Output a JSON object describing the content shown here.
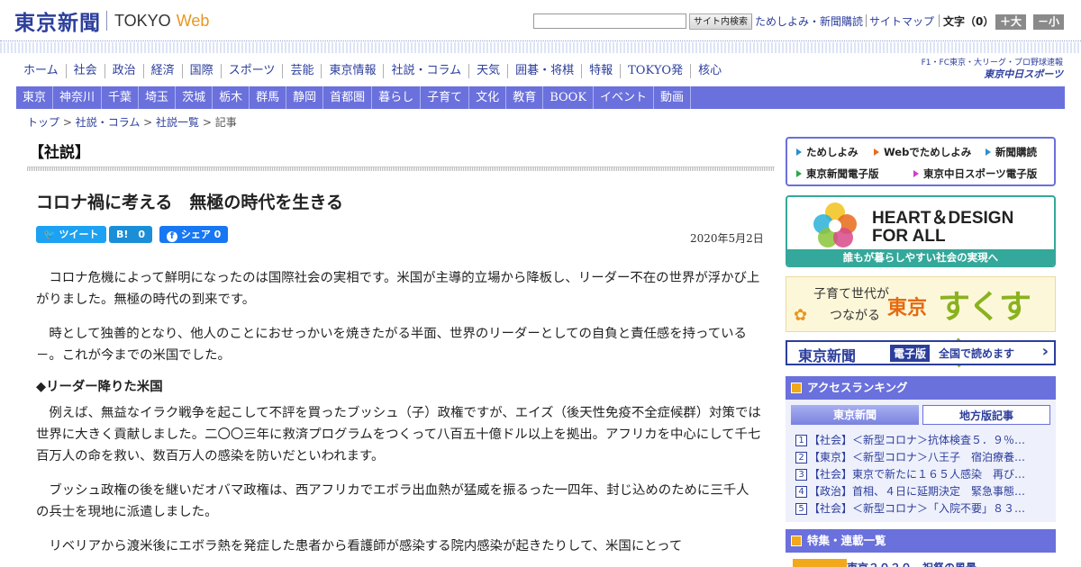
{
  "header": {
    "logo_jp": "東京新聞",
    "logo_en1": "TOKYO",
    "logo_en2": "Web",
    "search_button": "サイト内検索",
    "links": [
      "ためしよみ・新聞購読",
      "サイトマップ"
    ],
    "fontsize_label": "文字（0）",
    "font_bigger": "＋大",
    "font_smaller": "－小"
  },
  "nav_primary": [
    "ホーム",
    "社会",
    "政治",
    "経済",
    "国際",
    "スポーツ",
    "芸能",
    "東京情報",
    "社説・コラム",
    "天気",
    "囲碁・将棋",
    "特報",
    "TOKYO発",
    "核心"
  ],
  "chunichi": {
    "line1": "F1・FC東京・大リーグ・プロ野球速報",
    "line2": "東京中日スポーツ"
  },
  "nav_regional": [
    "東京",
    "神奈川",
    "千葉",
    "埼玉",
    "茨城",
    "栃木",
    "群馬",
    "静岡",
    "首都圏",
    "暮らし",
    "子育て",
    "文化",
    "教育",
    "BOOK",
    "イベント",
    "動画"
  ],
  "breadcrumb": {
    "items": [
      "トップ",
      "社説・コラム",
      "社説一覧"
    ],
    "current": "記事",
    "sep": " > "
  },
  "article": {
    "section": "【社説】",
    "headline": "コロナ禍に考える　無極の時代を生きる",
    "share": {
      "tweet": "ツイート",
      "hatena": "B!　0",
      "facebook": "シェア 0"
    },
    "date": "2020年5月2日",
    "paragraphs": [
      "コロナ危機によって鮮明になったのは国際社会の実相です。米国が主導的立場から降板し、リーダー不在の世界が浮かび上がりました。無極の時代の到来です。",
      "時として独善的となり、他人のことにおせっかいを焼きたがる半面、世界のリーダーとしての自負と責任感を持っている－。これが今までの米国でした。",
      "例えば、無益なイラク戦争を起こして不評を買ったブッシュ（子）政権ですが、エイズ（後天性免疫不全症候群）対策では世界に大きく貢献しました。二〇〇三年に救済プログラムをつくって八百五十億ドル以上を拠出。アフリカを中心にして千七百万人の命を救い、数百万人の感染を防いだといわれます。",
      "ブッシュ政権の後を継いだオバマ政権は、西アフリカでエボラ出血熱が猛威を振るった一四年、封じ込めのために三千人の兵士を現地に派遣しました。",
      "リベリアから渡米後にエボラ熱を発症した患者から看護師が感染する院内感染が起きたりして、米国にとって"
    ],
    "subhead": "◆リーダー降りた米国"
  },
  "sidebar": {
    "links": [
      "ためしよみ",
      "Webでためしよみ",
      "新聞購読",
      "東京新聞電子版",
      "東京中日スポーツ電子版"
    ],
    "heart_line1": "HEART＆DESIGN",
    "heart_line2": "FOR ALL",
    "heart_caption": "誰もが暮らしやすい社会の実現へ",
    "suku_line1": "子育て世代が",
    "suku_line2": "つながる",
    "suku_tokyo": "東京",
    "suku_logo": "すくすく",
    "eshimbun_title": "東京新聞",
    "eshimbun_badge": "電子版",
    "eshimbun_text": "全国で読めます",
    "eshimbun_arrow": "›",
    "ranking_title": "アクセスランキング",
    "ranking_tabs": [
      "東京新聞",
      "地方版記事"
    ],
    "ranking": [
      "【社会】＜新型コロナ＞抗体検査５．９％…",
      "【東京】＜新型コロナ＞八王子　宿泊療養…",
      "【社会】東京で新たに１６５人感染　再び…",
      "【政治】首相、４日に延期決定　緊急事態…",
      "【社会】＜新型コロナ＞「入院不要」８３…"
    ],
    "feature_title": "特集・連載一覧",
    "feature_partial": "東京２０２０　祝祭の風景"
  },
  "colors": {
    "nav_blue": "#6a70dc",
    "logo_blue": "#2c3e9c",
    "web_orange": "#e8961e",
    "teal": "#34a89a"
  }
}
